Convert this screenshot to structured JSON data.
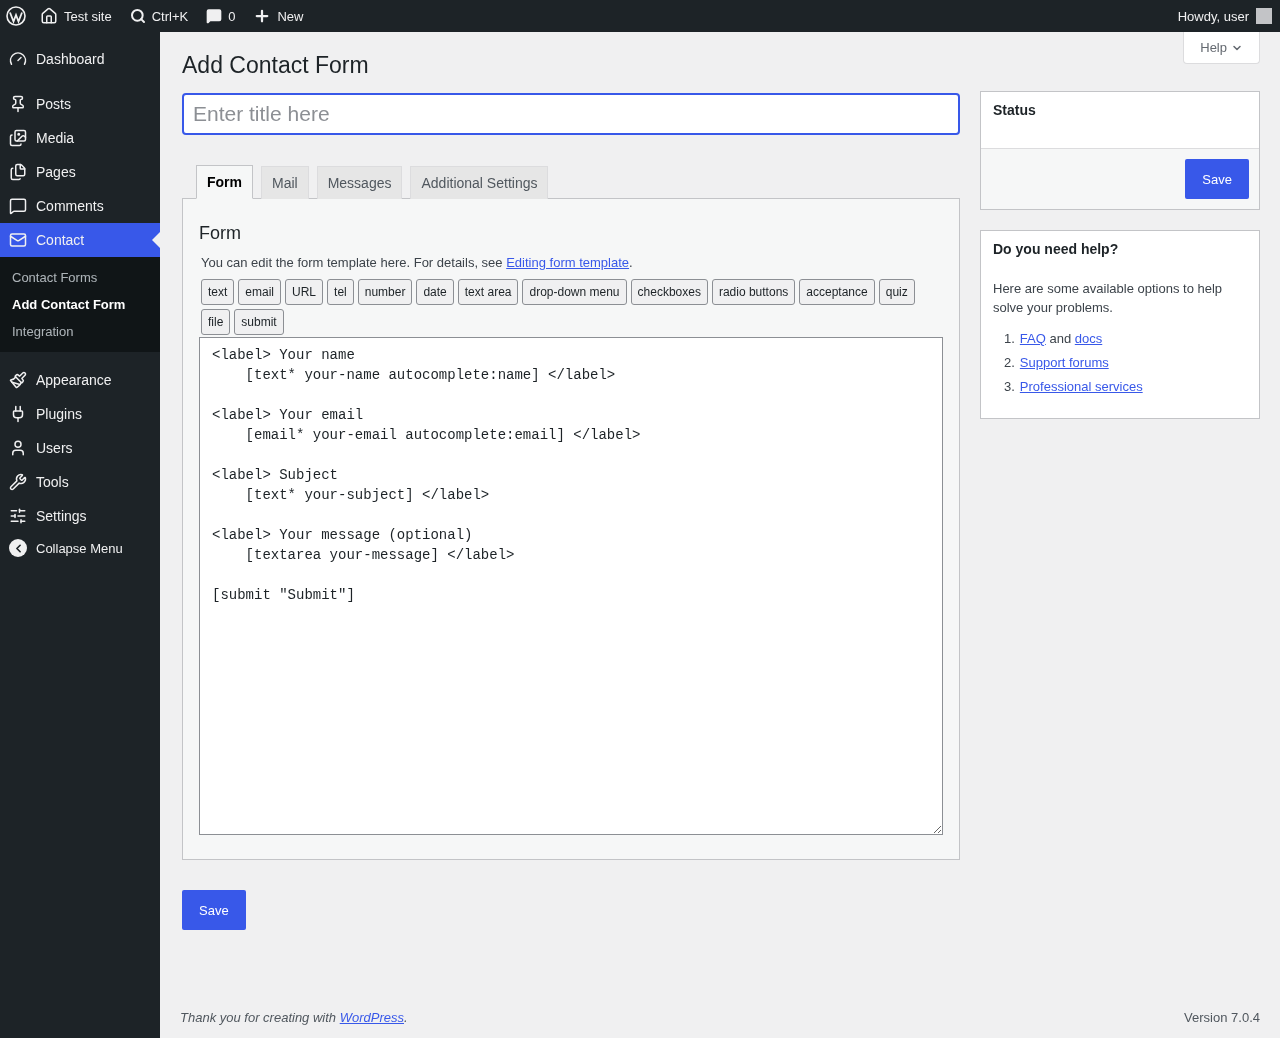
{
  "admin_bar": {
    "site": "Test site",
    "search_shortcut": "Ctrl+K",
    "comments_count": "0",
    "new": "New",
    "greeting": "Howdy, user"
  },
  "sidebar": {
    "items": [
      {
        "label": "Dashboard",
        "selected": false
      },
      {
        "label": "Posts",
        "selected": false
      },
      {
        "label": "Media",
        "selected": false
      },
      {
        "label": "Pages",
        "selected": false
      },
      {
        "label": "Comments",
        "selected": false
      },
      {
        "label": "Contact",
        "selected": true,
        "children": [
          {
            "label": "Contact Forms",
            "selected": false
          },
          {
            "label": "Add Contact Form",
            "selected": true
          },
          {
            "label": "Integration",
            "selected": false
          }
        ]
      },
      {
        "label": "Appearance",
        "selected": false
      },
      {
        "label": "Plugins",
        "selected": false
      },
      {
        "label": "Users",
        "selected": false
      },
      {
        "label": "Tools",
        "selected": false
      },
      {
        "label": "Settings",
        "selected": false
      }
    ],
    "collapse": "Collapse Menu"
  },
  "help_tab": "Help",
  "page_title": "Add Contact Form",
  "title_field": {
    "placeholder": "Enter title here"
  },
  "tabs": [
    {
      "label": "Form",
      "selected": true
    },
    {
      "label": "Mail",
      "selected": false
    },
    {
      "label": "Messages",
      "selected": false
    },
    {
      "label": "Additional Settings",
      "selected": false
    }
  ],
  "form_panel": {
    "heading": "Form",
    "intro": "You can edit the form template here. For details, see ",
    "intro_link": "Editing form template",
    "intro_end": ".",
    "tag_buttons": [
      "text",
      "email",
      "URL",
      "tel",
      "number",
      "date",
      "text area",
      "drop-down menu",
      "checkboxes",
      "radio buttons",
      "acceptance",
      "quiz",
      "file",
      "submit"
    ],
    "template": "<label> Your name\n    [text* your-name autocomplete:name] </label>\n\n<label> Your email\n    [email* your-email autocomplete:email] </label>\n\n<label> Subject\n    [text* your-subject] </label>\n\n<label> Your message (optional)\n    [textarea your-message] </label>\n\n[submit \"Submit\"]"
  },
  "save_button": "Save",
  "status_box": {
    "title": "Status",
    "save": "Save"
  },
  "help_box": {
    "title": "Do you need help?",
    "text": "Here are some available options to help solve your problems.",
    "items": [
      {
        "number": "1.",
        "parts": [
          {
            "text": "FAQ",
            "link": true
          },
          {
            "text": " and ",
            "link": false
          },
          {
            "text": "docs",
            "link": true
          }
        ]
      },
      {
        "number": "2.",
        "parts": [
          {
            "text": "Support forums",
            "link": true
          }
        ]
      },
      {
        "number": "3.",
        "parts": [
          {
            "text": "Professional services",
            "link": true
          }
        ]
      }
    ]
  },
  "footer": {
    "text": "Thank you for creating with ",
    "link": "WordPress",
    "end": ".",
    "version": "Version 7.0.4"
  }
}
